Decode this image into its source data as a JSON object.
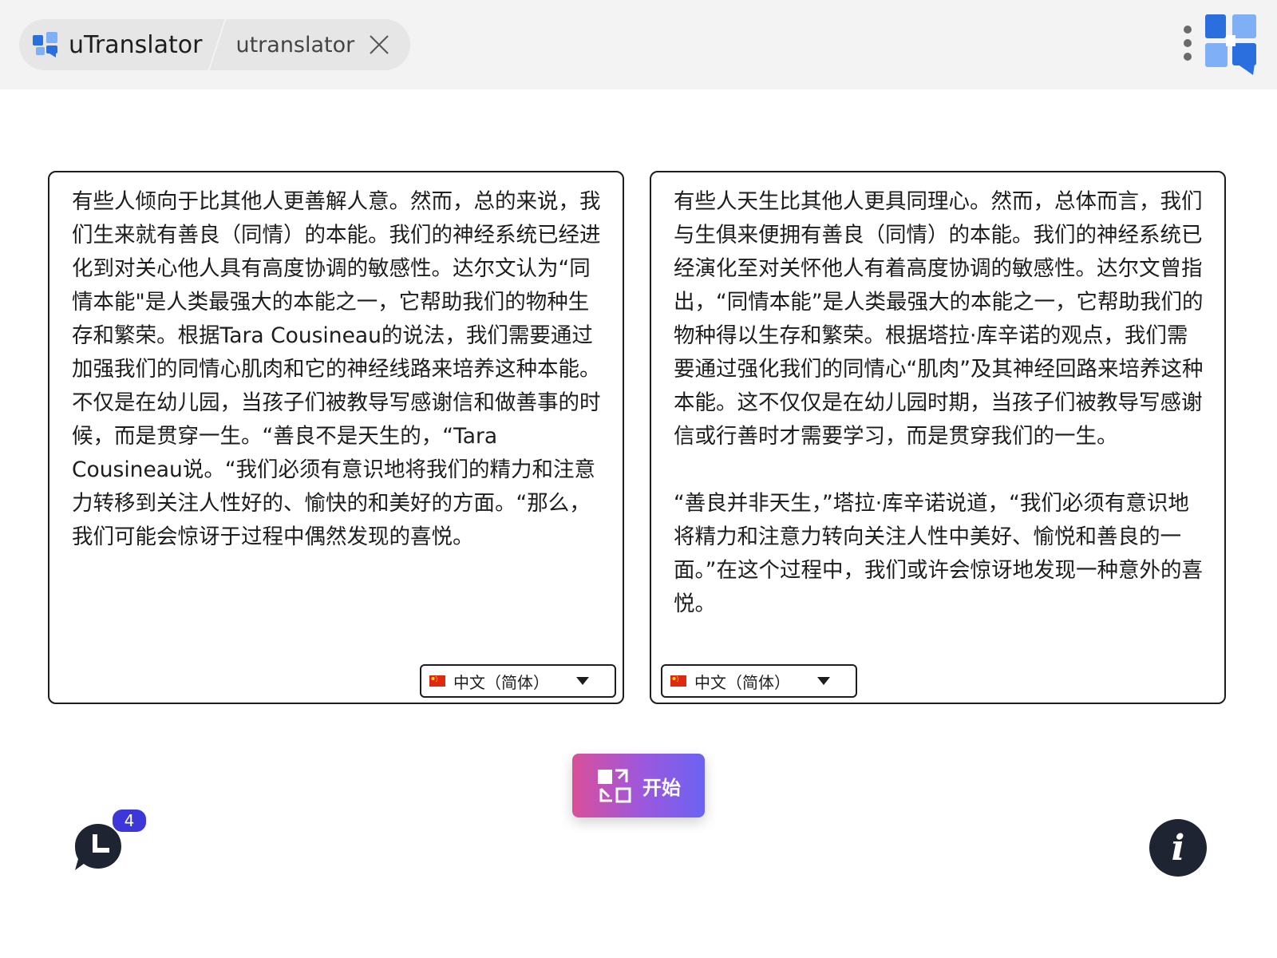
{
  "app": {
    "tab_name": "uTranslator",
    "sub_tab_name": "utranslator",
    "accent_color": "#2b6fde"
  },
  "source": {
    "text": "有些人倾向于比其他人更善解人意。然而，总的来说，我们生来就有善良（同情）的本能。我们的神经系统已经进化到对关心他人具有高度协调的敏感性。达尔文认为“同情本能\"是人类最强大的本能之一，它帮助我们的物种生存和繁荣。根据Tara Cousineau的说法，我们需要通过加强我们的同情心肌肉和它的神经线路来培养这种本能。不仅是在幼儿园，当孩子们被教导写感谢信和做善事的时候，而是贯穿一生。“善良不是天生的，“Tara Cousineau说。“我们必须有意识地将我们的精力和注意力转移到关注人性好的、愉快的和美好的方面。“那么，我们可能会惊讶于过程中偶然发现的喜悦。",
    "language": "中文（简体）"
  },
  "target": {
    "text": "有些人天生比其他人更具同理心。然而，总体而言，我们与生俱来便拥有善良（同情）的本能。我们的神经系统已经演化至对关怀他人有着高度协调的敏感性。达尔文曾指出，“同情本能”是人类最强大的本能之一，它帮助我们的物种得以生存和繁荣。根据塔拉·库辛诺的观点，我们需要通过强化我们的同情心“肌肉”及其神经回路来培养这种本能。这不仅仅是在幼儿园时期，当孩子们被教导写感谢信或行善时才需要学习，而是贯穿我们的一生。\n\n“善良并非天生，”塔拉·库辛诺说道，“我们必须有意识地将精力和注意力转向关注人性中美好、愉悦和善良的一面。”在这个过程中，我们或许会惊讶地发现一种意外的喜悦。",
    "language": "中文（简体）"
  },
  "actions": {
    "start_label": "开始"
  },
  "history": {
    "badge_count": "4"
  },
  "info": {
    "label": "i"
  },
  "icons": {
    "app": "utranslator-logo-icon",
    "close": "close-icon",
    "menu": "more-vertical-icon",
    "flag": "china-flag-icon",
    "caret": "chevron-down-icon",
    "swap": "swap-icon",
    "history": "history-chat-icon",
    "info": "info-icon"
  }
}
